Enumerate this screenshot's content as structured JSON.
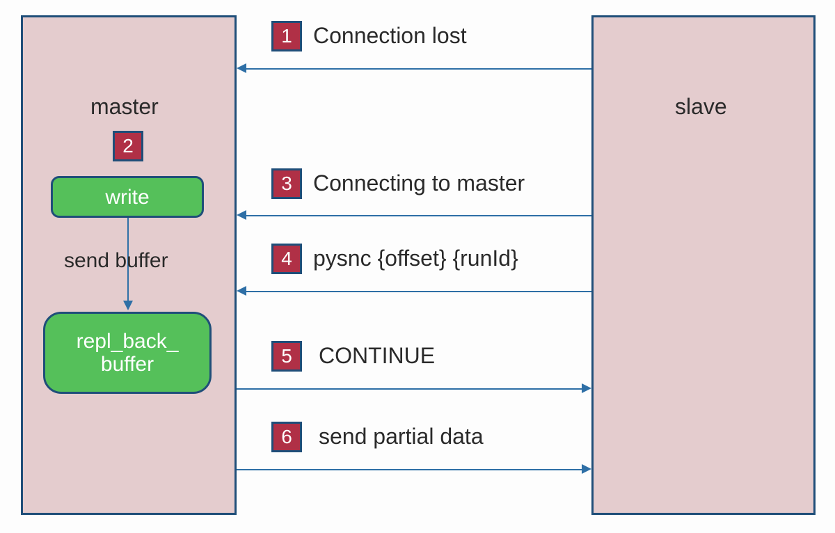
{
  "master": {
    "title": "master",
    "step2_badge": "2",
    "write_label": "write",
    "send_buffer_label": "send buffer",
    "repl_back_buffer_label": "repl_back_\nbuffer"
  },
  "slave": {
    "title": "slave"
  },
  "steps": [
    {
      "num": "1",
      "text": "Connection lost",
      "direction": "left"
    },
    {
      "num": "3",
      "text": "Connecting to master",
      "direction": "left"
    },
    {
      "num": "4",
      "text": "pysnc {offset} {runId}",
      "direction": "left"
    },
    {
      "num": "5",
      "text": "CONTINUE",
      "direction": "right"
    },
    {
      "num": "6",
      "text": "send partial data",
      "direction": "right"
    }
  ],
  "colors": {
    "box_fill": "#e4ccce",
    "box_border": "#1f4e79",
    "badge_fill": "#b03046",
    "green_fill": "#55c05a",
    "arrow": "#2e6fa6"
  },
  "chart_data": {
    "type": "sequence-diagram",
    "participants": [
      "master",
      "slave"
    ],
    "internal_master": [
      "write",
      "send buffer",
      "repl_back_buffer"
    ],
    "messages": [
      {
        "step": 1,
        "from": "slave",
        "to": "master",
        "label": "Connection lost"
      },
      {
        "step": 2,
        "at": "master",
        "label": "write → repl_back_buffer (send buffer)"
      },
      {
        "step": 3,
        "from": "slave",
        "to": "master",
        "label": "Connecting to master"
      },
      {
        "step": 4,
        "from": "slave",
        "to": "master",
        "label": "pysnc {offset} {runId}"
      },
      {
        "step": 5,
        "from": "master",
        "to": "slave",
        "label": "CONTINUE"
      },
      {
        "step": 6,
        "from": "master",
        "to": "slave",
        "label": "send partial data"
      }
    ]
  }
}
